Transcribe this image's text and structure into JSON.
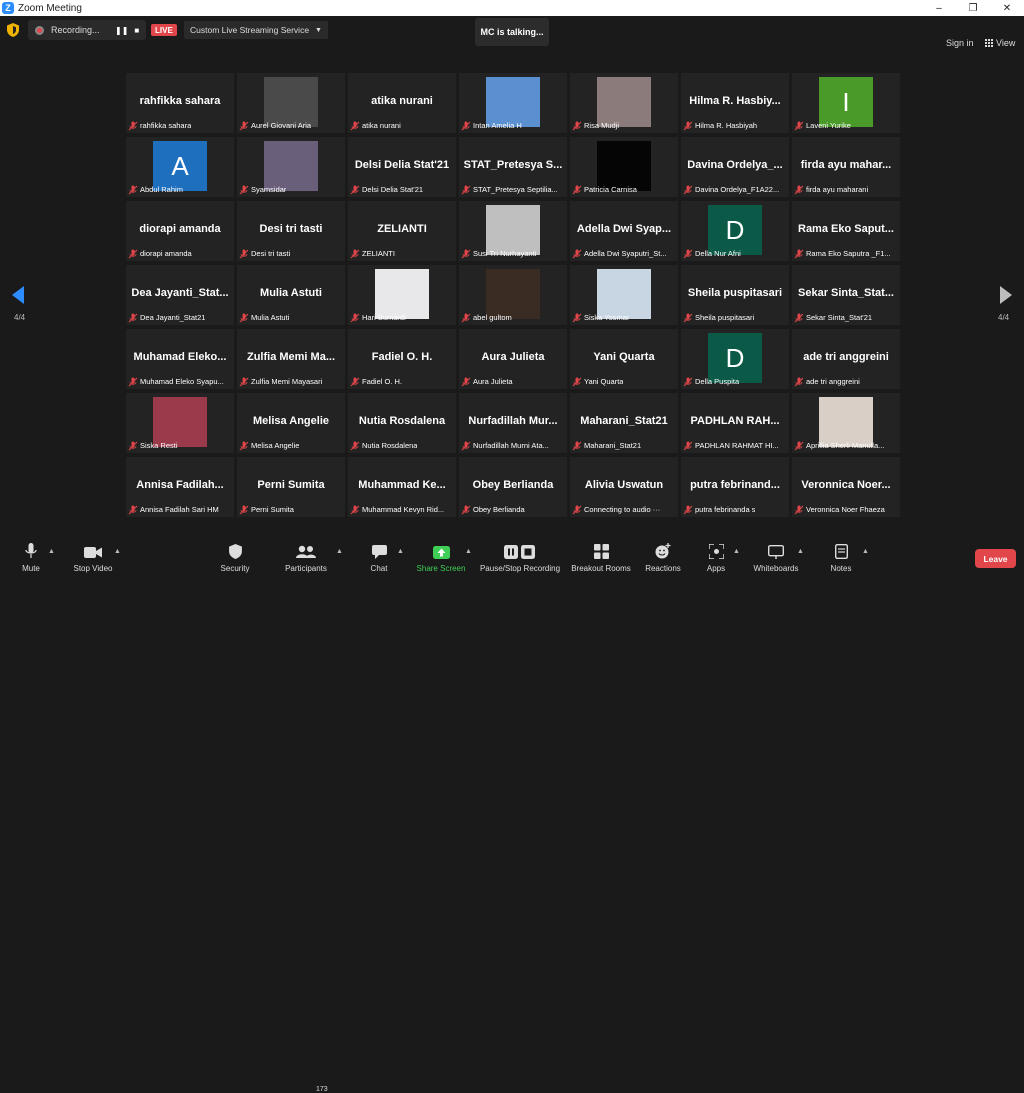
{
  "window": {
    "title": "Zoom Meeting",
    "controls": [
      "–",
      "❐",
      "✕"
    ]
  },
  "topbar": {
    "recording_label": "Recording...",
    "live_label": "LIVE",
    "stream_label": "Custom Live Streaming Service",
    "talking": "MC is talking...",
    "signin": "Sign in",
    "view": "View"
  },
  "pager": {
    "left": "4/4",
    "right": "4/4"
  },
  "colors": {
    "accent": "#2D8CFF",
    "live": "#E0464A",
    "share": "#3FCF56",
    "leave": "#E0464A"
  },
  "tiles": [
    {
      "name": "rahfikka sahara",
      "big": "rahfikka sahara"
    },
    {
      "name": "Aurel Giovani Aria",
      "photo": "#4a4a4a"
    },
    {
      "name": "atika nurani",
      "big": "atika nurani"
    },
    {
      "name": "Intan Amelia H",
      "photo": "#5a8fd0"
    },
    {
      "name": "Risa Mudji",
      "photo": "#8b7b7b"
    },
    {
      "name": "Hilma R. Hasbiyah",
      "big": "Hilma R. Hasbiy..."
    },
    {
      "name": "Laveni Yurike",
      "letter": "I",
      "color": "#4a9a2a"
    },
    {
      "name": "Abdul Rahim",
      "letter": "A",
      "color": "#1f6fbf"
    },
    {
      "name": "Syamsidar",
      "photo": "#6a5f7a"
    },
    {
      "name": "Delsi Delia Stat'21",
      "big": "Delsi Delia Stat'21"
    },
    {
      "name": "STAT_Pretesya Septilia...",
      "big": "STAT_Pretesya S..."
    },
    {
      "name": "Patricia Carnisa",
      "photo": "#050505"
    },
    {
      "name": "Davina Ordelya_F1A22...",
      "big": "Davina Ordelya_..."
    },
    {
      "name": "firda ayu maharani",
      "big": "firda ayu mahar..."
    },
    {
      "name": "diorapi amanda",
      "big": "diorapi amanda"
    },
    {
      "name": "Desi tri tasti",
      "big": "Desi tri tasti"
    },
    {
      "name": "ZELIANTI",
      "big": "ZELIANTI"
    },
    {
      "name": "Susi Tri Nurhayanti",
      "photo": "#bfbfbf"
    },
    {
      "name": "Adella Dwi Syaputri_St...",
      "big": "Adella Dwi Syap..."
    },
    {
      "name": "Della Nur Afni",
      "letter": "D",
      "color": "#0b5a48"
    },
    {
      "name": "Rama Eko Saputra _F1...",
      "big": "Rama Eko Saput..."
    },
    {
      "name": "Dea Jayanti_Stat21",
      "big": "Dea Jayanti_Stat..."
    },
    {
      "name": "Mulia Astuti",
      "big": "Mulia Astuti"
    },
    {
      "name": "Hari Sumardi",
      "photo": "#e8e8ea"
    },
    {
      "name": "abel gultom",
      "photo": "#3a2c22"
    },
    {
      "name": "Siska Yosmar",
      "photo": "#c8d6e4"
    },
    {
      "name": "Sheila puspitasari",
      "big": "Sheila puspitasari"
    },
    {
      "name": "Sekar Sinta_Stat'21",
      "big": "Sekar Sinta_Stat..."
    },
    {
      "name": "Muhamad Eleko Syapu...",
      "big": "Muhamad Eleko..."
    },
    {
      "name": "Zulfia Memi Mayasari",
      "big": "Zulfia Memi Ma..."
    },
    {
      "name": "Fadiel O. H.",
      "big": "Fadiel O. H."
    },
    {
      "name": "Aura Julieta",
      "big": "Aura Julieta"
    },
    {
      "name": "Yani Quarta",
      "big": "Yani Quarta"
    },
    {
      "name": "Della Puspita",
      "letter": "D",
      "color": "#0b5a48"
    },
    {
      "name": "ade tri anggreini",
      "big": "ade tri anggreini"
    },
    {
      "name": "Siska Resti",
      "photo": "#9a3a4a"
    },
    {
      "name": "Melisa Angelie",
      "big": "Melisa Angelie"
    },
    {
      "name": "Nutia Rosdalena",
      "big": "Nutia Rosdalena"
    },
    {
      "name": "Nurfadillah Murni Ata...",
      "big": "Nurfadillah Mur..."
    },
    {
      "name": "Maharani_Stat21",
      "big": "Maharani_Stat21"
    },
    {
      "name": "PADHLAN RAHMAT HI...",
      "big": "PADHLAN RAH..."
    },
    {
      "name": "Aprillia Sherli Manulla...",
      "photo": "#d9cfc6"
    },
    {
      "name": "Annisa Fadilah Sari HM",
      "big": "Annisa Fadilah..."
    },
    {
      "name": "Perni Sumita",
      "big": "Perni Sumita"
    },
    {
      "name": "Muhammad Kevyn Rid...",
      "big": "Muhammad Ke..."
    },
    {
      "name": "Obey Berlianda",
      "big": "Obey Berlianda"
    },
    {
      "name": "Connecting to audio ···",
      "big": "Alivia Uswatun"
    },
    {
      "name": "putra febrinanda s",
      "big": "putra febrinand..."
    },
    {
      "name": "Veronnica Noer Fhaeza",
      "big": "Veronnica Noer..."
    }
  ],
  "toolbar": {
    "mute": "Mute",
    "stop_video": "Stop Video",
    "security": "Security",
    "participants": "Participants",
    "participants_count": "173",
    "chat": "Chat",
    "share_screen": "Share Screen",
    "pause_recording": "Pause/Stop Recording",
    "breakout": "Breakout Rooms",
    "reactions": "Reactions",
    "apps": "Apps",
    "whiteboards": "Whiteboards",
    "notes": "Notes",
    "leave": "Leave"
  }
}
